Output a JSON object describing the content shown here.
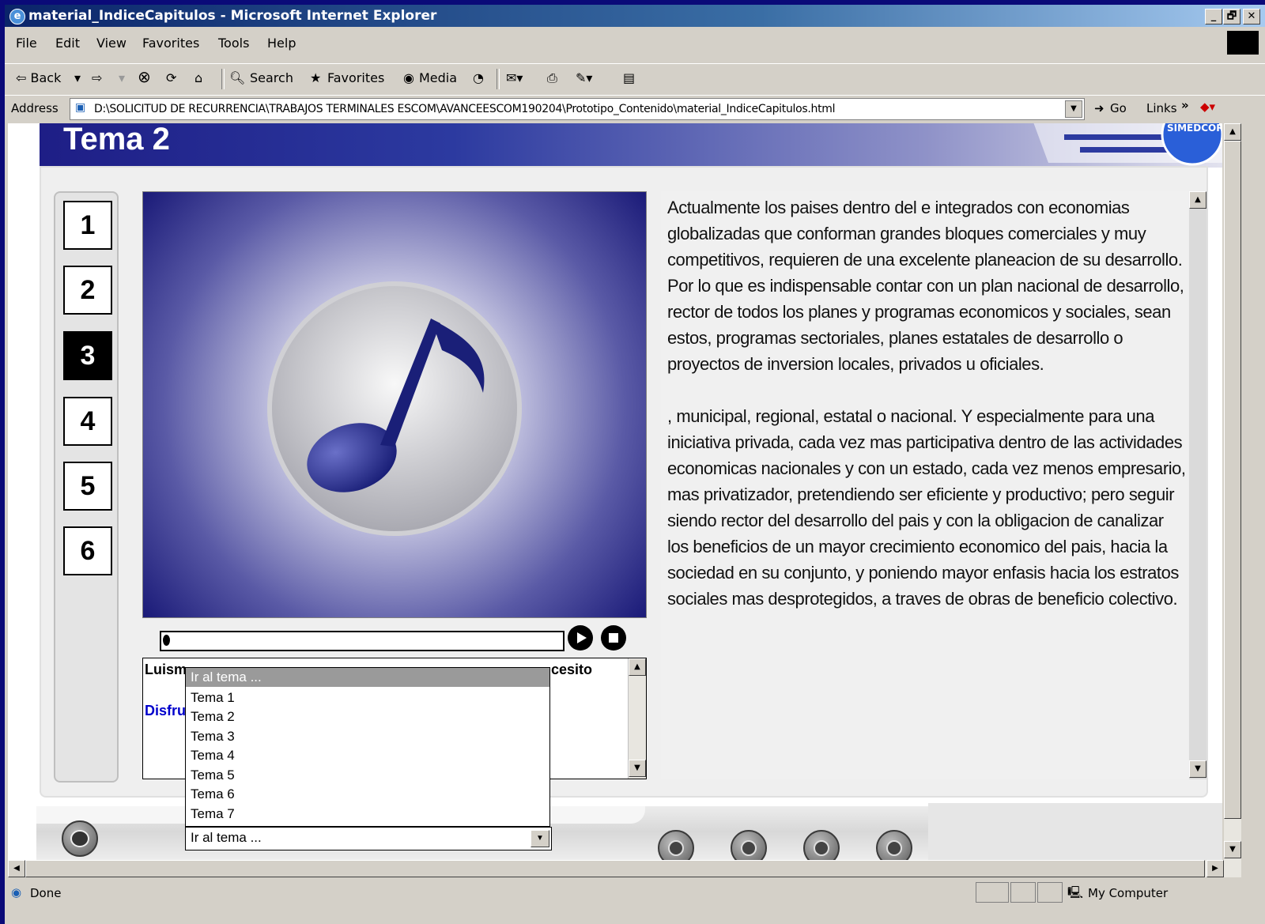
{
  "window": {
    "title": "material_IndiceCapitulos - Microsoft Internet Explorer",
    "controls": [
      "_",
      "🗗",
      "✕"
    ]
  },
  "menu": [
    "File",
    "Edit",
    "View",
    "Favorites",
    "Tools",
    "Help"
  ],
  "toolbar": {
    "back": "⇦ Back",
    "forward": "⇨",
    "search": "Search",
    "favorites": "Favorites",
    "media": "Media"
  },
  "address": {
    "label": "Address",
    "value": "D:\\SOLICITUD DE RECURRENCIA\\TRABAJOS TERMINALES ESCOM\\AVANCEESCOM190204\\Prototipo_Contenido\\material_IndiceCapitulos.html",
    "go": "Go",
    "links": "Links"
  },
  "page": {
    "banner_title": "Tema 2",
    "logo_text": "SIMEDCOR",
    "chapters": [
      "1",
      "2",
      "3",
      "4",
      "5",
      "6"
    ],
    "active_chapter": "3",
    "caption_line1": "Luism",
    "caption_line1_tail": "cesito",
    "caption_line2": "Disfru",
    "paragraph1": "Actualmente los paises dentro del  e integrados con economias globalizadas que conforman grandes bloques comerciales y muy competitivos, requieren de una excelente planeacion de su desarrollo. Por lo que es indispensable contar con un plan nacional de desarrollo, rector de todos los planes y programas economicos y sociales, sean estos, programas sectoriales, planes estatales de desarrollo o proyectos de inversion locales, privados u oficiales.",
    "paragraph2": ", municipal, regional, estatal o nacional. Y especialmente para una iniciativa privada, cada vez mas participativa dentro de las actividades economicas nacionales y con un estado, cada vez menos empresario, mas privatizador, pretendiendo ser eficiente y productivo; pero seguir siendo rector del desarrollo del pais y con la obligacion de canalizar los beneficios de un mayor crecimiento economico del pais, hacia la sociedad en su  conjunto, y poniendo mayor enfasis hacia los estratos sociales  mas desprotegidos, a traves de obras de beneficio colectivo.",
    "dropdown_options": [
      "Ir al tema ...",
      "Tema 1",
      "Tema 2",
      "Tema 3",
      "Tema 4",
      "Tema 5",
      "Tema 6",
      "Tema 7"
    ],
    "combo_value": "Ir al tema ..."
  },
  "status": {
    "text": "Done",
    "zone": "My Computer"
  },
  "colors": {
    "desktop": "#0a0a78",
    "titlebar": "#0a246a",
    "banner": "#2c3aa0",
    "note": "#1f2a8a"
  }
}
